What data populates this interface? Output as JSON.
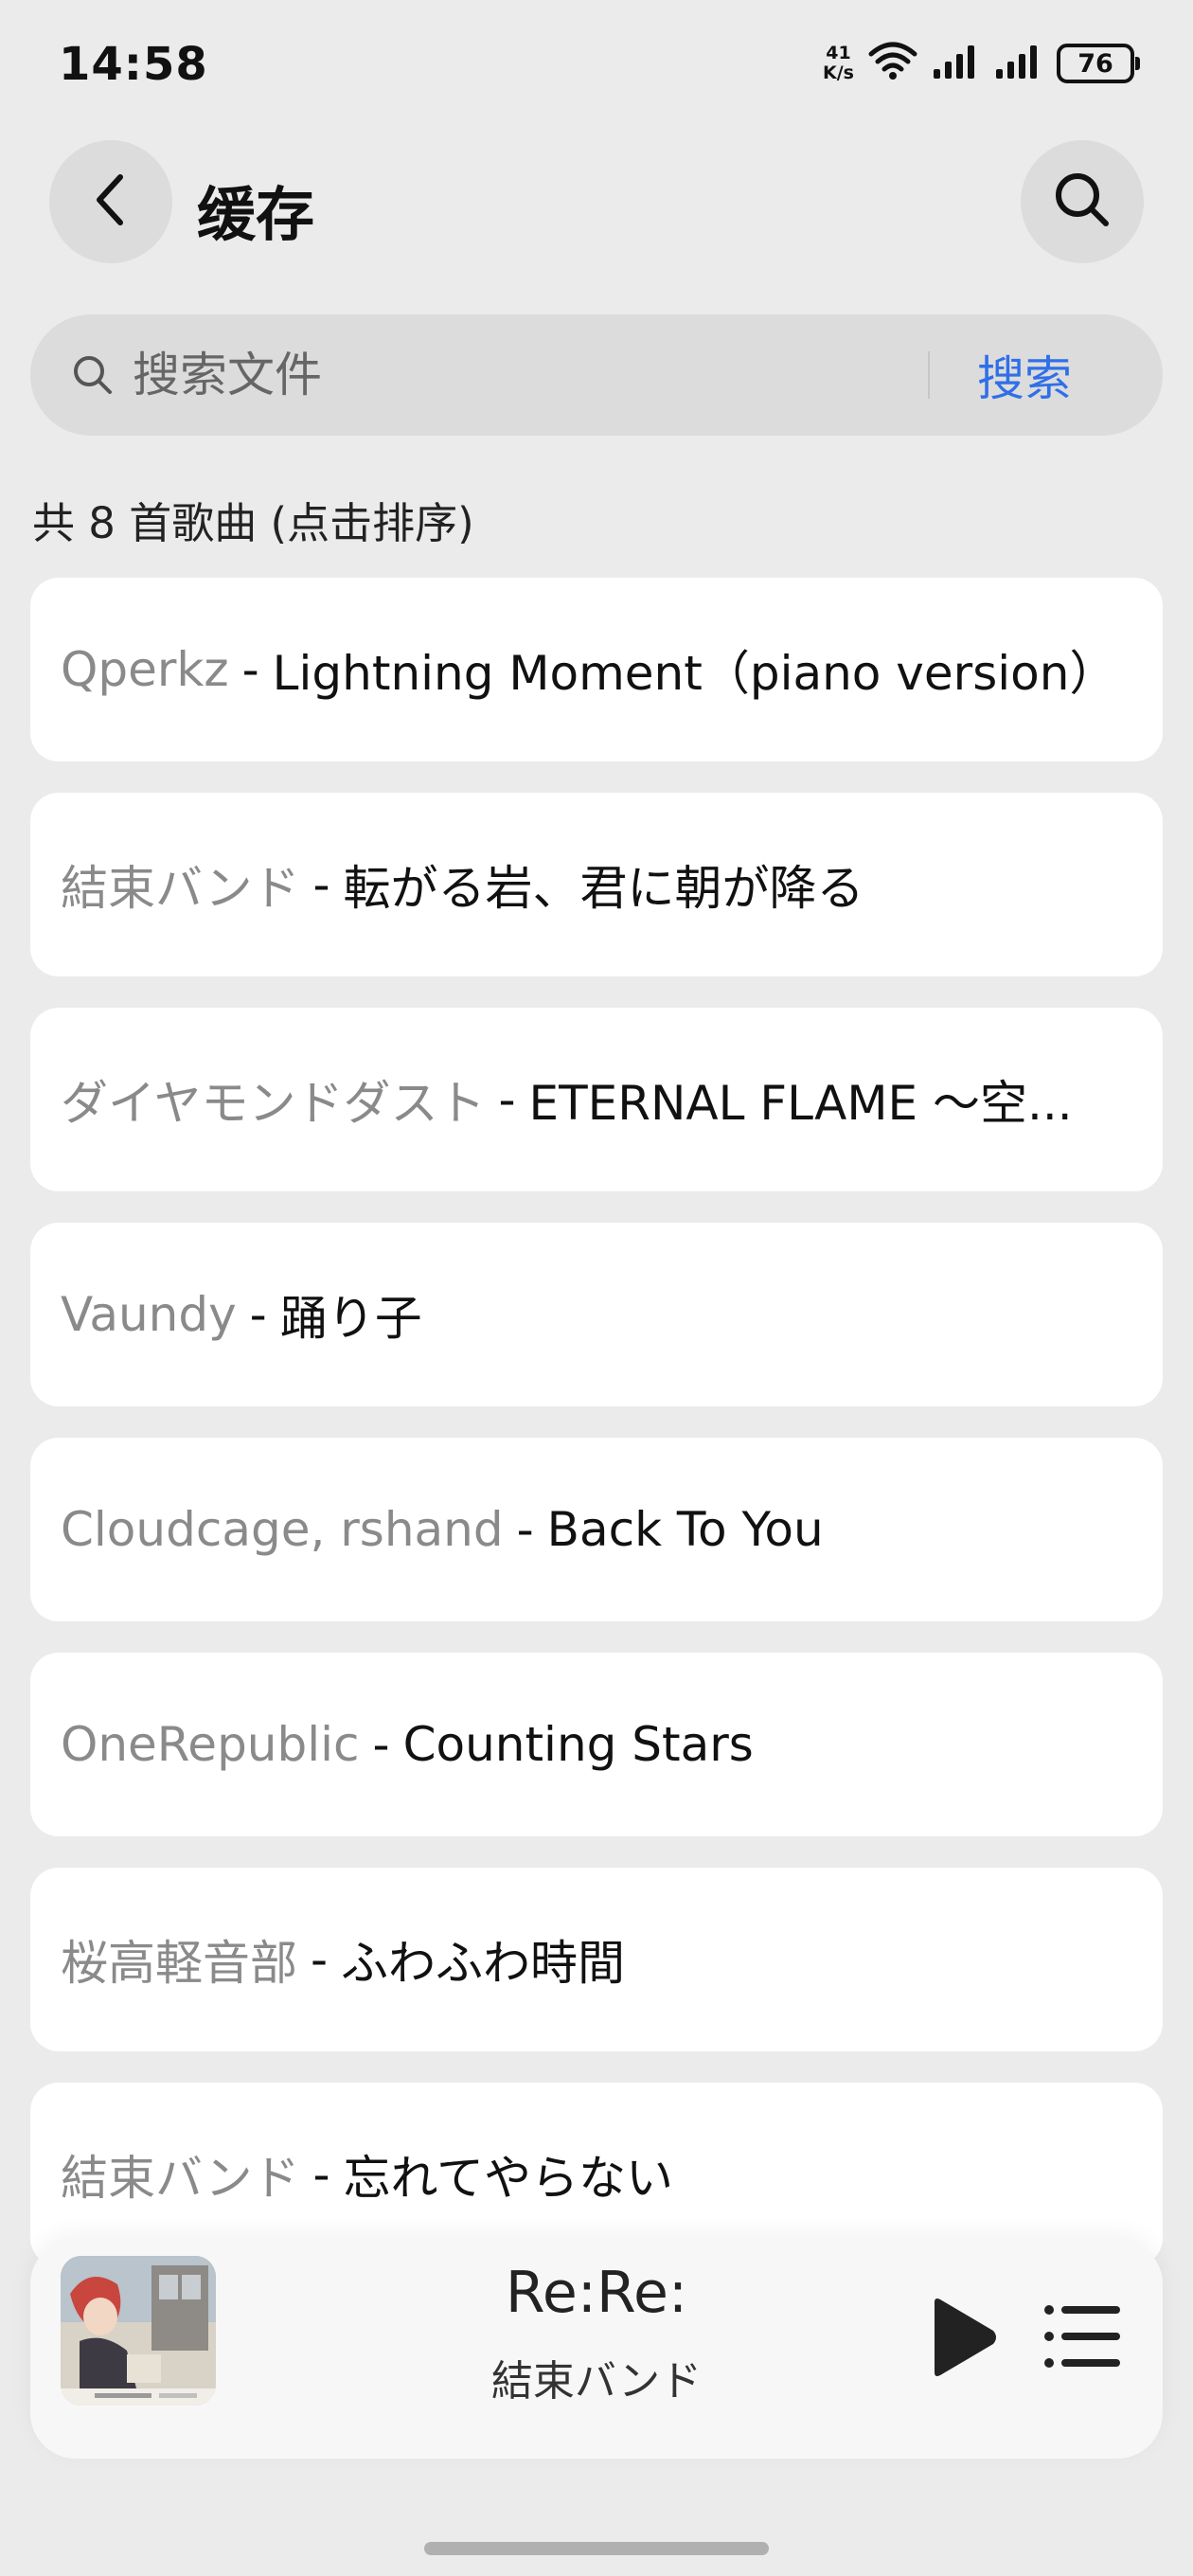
{
  "status_bar": {
    "time": "14:58",
    "net_speed_value": "41",
    "net_speed_unit": "K/s",
    "battery": "76"
  },
  "header": {
    "title": "缓存",
    "back_icon": "chevron-left-icon",
    "search_icon": "search-icon"
  },
  "search": {
    "placeholder": "搜索文件",
    "submit_label": "搜索"
  },
  "list": {
    "count_label": "共 8 首歌曲 (点击排序)",
    "separator": "-",
    "songs": [
      {
        "artist": "Qperkz",
        "title": "Lightning Moment（piano version）"
      },
      {
        "artist": "結束バンド",
        "title": "転がる岩、君に朝が降る"
      },
      {
        "artist": "ダイヤモンドダスト",
        "title": "ETERNAL FLAME ～空..."
      },
      {
        "artist": "Vaundy",
        "title": "踊り子"
      },
      {
        "artist": "Cloudcage, rshand",
        "title": "Back To You"
      },
      {
        "artist": "OneRepublic",
        "title": "Counting Stars"
      },
      {
        "artist": "桜高軽音部",
        "title": "ふわふわ時間"
      },
      {
        "artist": "結束バンド",
        "title": "忘れてやらない"
      }
    ]
  },
  "player": {
    "title": "Re:Re:",
    "artist": "結束バンド",
    "play_icon": "play-icon",
    "queue_icon": "playlist-icon"
  },
  "colors": {
    "background": "#ebebeb",
    "accent": "#2f6fe8",
    "artist_text": "#8a8a8a"
  }
}
